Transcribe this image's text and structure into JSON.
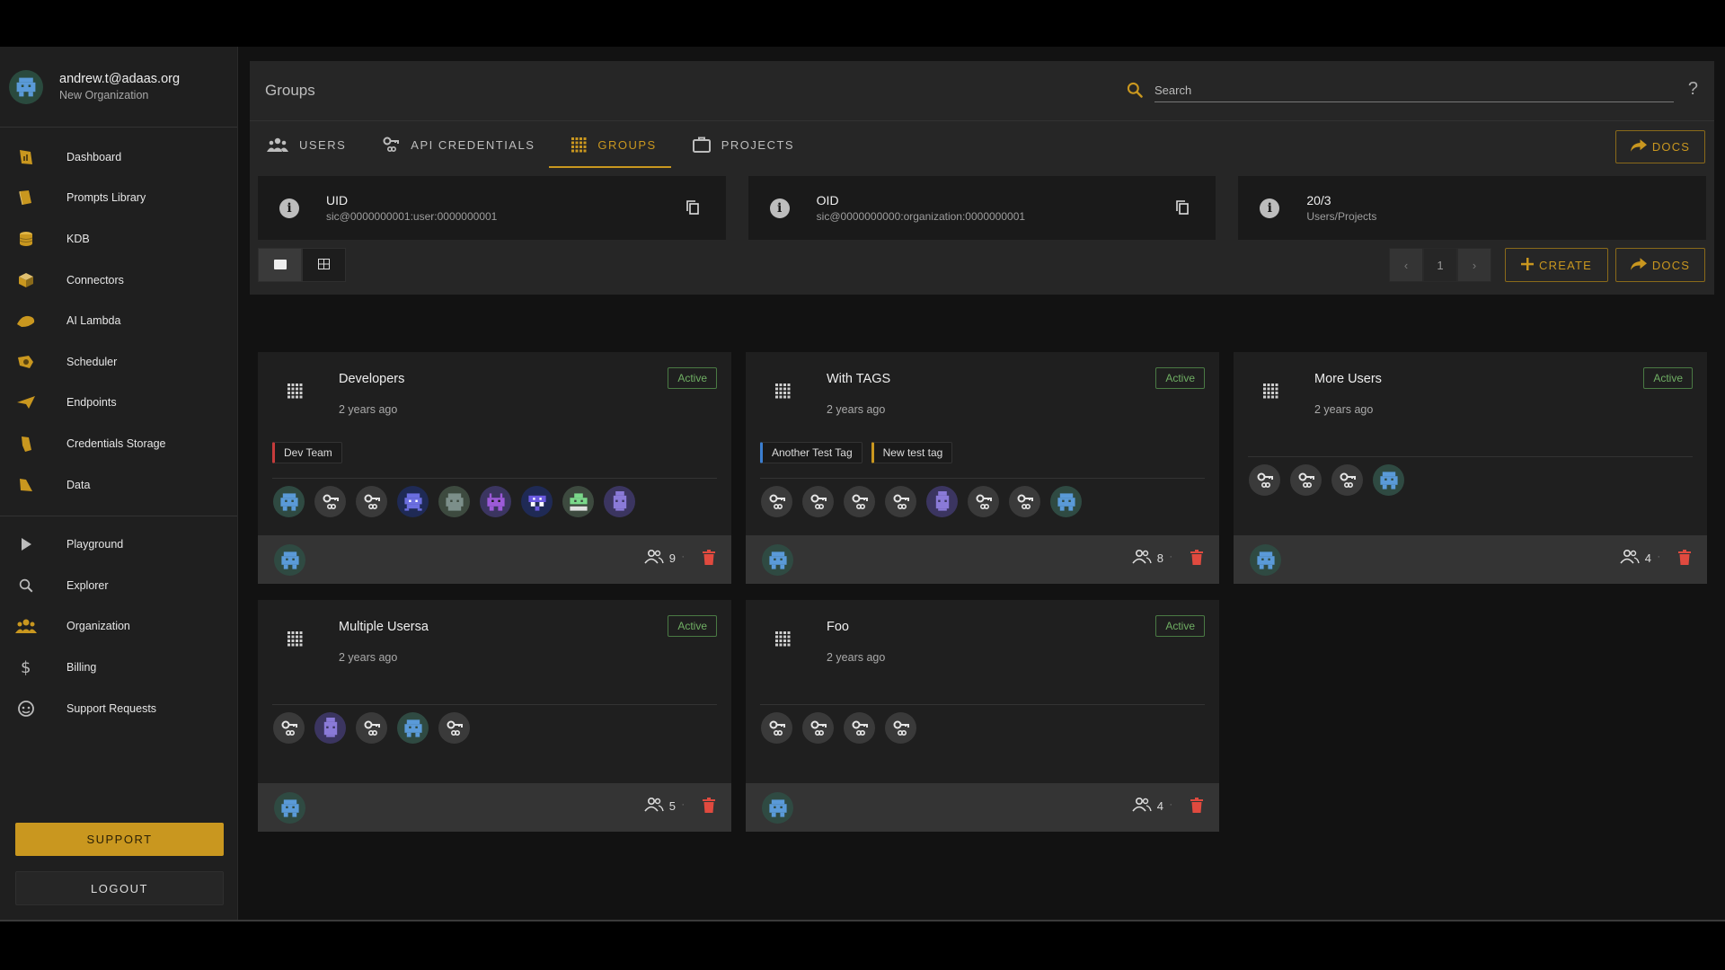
{
  "user": {
    "email": "andrew.t@adaas.org",
    "organization": "New Organization"
  },
  "nav": {
    "primary": [
      {
        "label": "Dashboard",
        "icon": "dashboard-icon"
      },
      {
        "label": "Prompts Library",
        "icon": "book-icon"
      },
      {
        "label": "KDB",
        "icon": "database-icon"
      },
      {
        "label": "Connectors",
        "icon": "cube-icon"
      },
      {
        "label": "AI Lambda",
        "icon": "lambda-icon"
      },
      {
        "label": "Scheduler",
        "icon": "scheduler-icon"
      },
      {
        "label": "Endpoints",
        "icon": "send-icon"
      },
      {
        "label": "Credentials Storage",
        "icon": "shield-icon"
      },
      {
        "label": "Data",
        "icon": "folder-icon"
      }
    ],
    "secondary": [
      {
        "label": "Playground",
        "icon": "play-icon"
      },
      {
        "label": "Explorer",
        "icon": "search-icon"
      },
      {
        "label": "Organization",
        "icon": "people-icon"
      },
      {
        "label": "Billing",
        "icon": "dollar-icon"
      },
      {
        "label": "Support Requests",
        "icon": "support-icon"
      }
    ]
  },
  "buttons": {
    "support": "SUPPORT",
    "logout": "LOGOUT",
    "docs": "DOCS",
    "create": "CREATE"
  },
  "header": {
    "title": "Groups",
    "search_placeholder": "Search",
    "help": "?"
  },
  "tabs": [
    {
      "label": "USERS",
      "icon": "users-icon",
      "active": false
    },
    {
      "label": "API CREDENTIALS",
      "icon": "key-icon",
      "active": false
    },
    {
      "label": "GROUPS",
      "icon": "grid-icon",
      "active": true
    },
    {
      "label": "PROJECTS",
      "icon": "briefcase-icon",
      "active": false
    }
  ],
  "info": [
    {
      "title": "UID",
      "value": "sic@0000000001:user:0000000001",
      "copy": true
    },
    {
      "title": "OID",
      "value": "sic@0000000000:organization:0000000001",
      "copy": true
    },
    {
      "title": "20/3",
      "value": "Users/Projects",
      "copy": false
    }
  ],
  "pager": {
    "prev": "‹",
    "page": "1",
    "next": "›"
  },
  "groups": [
    {
      "name": "Developers",
      "time": "2 years ago",
      "status": "Active",
      "tags": [
        {
          "label": "Dev Team",
          "color": "red"
        }
      ],
      "members": [
        "robot",
        "key",
        "key",
        "alien-blue",
        "robot-grey",
        "alien-purple",
        "alien-navy",
        "alien-green",
        "robot-purple"
      ],
      "count": "9"
    },
    {
      "name": "With TAGS",
      "time": "2 years ago",
      "status": "Active",
      "tags": [
        {
          "label": "Another Test Tag",
          "color": "blue"
        },
        {
          "label": "New test tag",
          "color": "yellow"
        }
      ],
      "members": [
        "key",
        "key",
        "key",
        "key",
        "robot-purple",
        "key",
        "key",
        "robot"
      ],
      "count": "8"
    },
    {
      "name": "More Users",
      "time": "2 years ago",
      "status": "Active",
      "tags": [],
      "members": [
        "key",
        "key",
        "key",
        "robot"
      ],
      "count": "4"
    },
    {
      "name": "Multiple Usersa",
      "time": "2 years ago",
      "status": "Active",
      "tags": [],
      "members": [
        "key",
        "robot-purple",
        "key",
        "robot",
        "key"
      ],
      "count": "5"
    },
    {
      "name": "Foo",
      "time": "2 years ago",
      "status": "Active",
      "tags": [],
      "members": [
        "key",
        "key",
        "key",
        "key"
      ],
      "count": "4"
    }
  ],
  "colors": {
    "accent": "#c9971f",
    "active_status": "#6fae63",
    "delete": "#e04a3f",
    "background": "#121212"
  }
}
